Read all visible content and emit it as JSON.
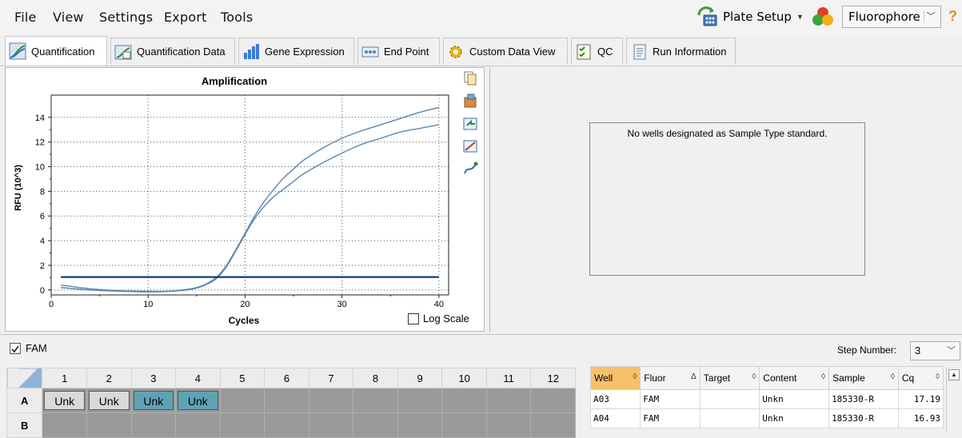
{
  "menu": {
    "items": [
      "File",
      "View",
      "Settings",
      "Export",
      "Tools"
    ],
    "plate_setup_label": "Plate Setup",
    "fluorophore_selected": "Fluorophore",
    "help_symbol": "?"
  },
  "tabs": [
    {
      "label": "Quantification",
      "icon": "amplification-curve-icon",
      "active": true
    },
    {
      "label": "Quantification Data",
      "icon": "quantification-data-icon",
      "active": false
    },
    {
      "label": "Gene Expression",
      "icon": "bar-chart-icon",
      "active": false
    },
    {
      "label": "End Point",
      "icon": "endpoint-icon",
      "active": false
    },
    {
      "label": "Custom Data View",
      "icon": "gear-icon",
      "active": false
    },
    {
      "label": "QC",
      "icon": "checklist-icon",
      "active": false
    },
    {
      "label": "Run Information",
      "icon": "document-icon",
      "active": false
    }
  ],
  "chart_data": {
    "type": "line",
    "title": "Amplification",
    "xlabel": "Cycles",
    "ylabel": "RFU (10^3)",
    "xlim": [
      0,
      41
    ],
    "ylim": [
      -0.4,
      15.8
    ],
    "xticks": [
      0,
      10,
      20,
      30,
      40
    ],
    "yticks": [
      0,
      2,
      4,
      6,
      8,
      10,
      12,
      14
    ],
    "grid": true,
    "series": [
      {
        "x": [
          1,
          4,
          7,
          10,
          12,
          14,
          15,
          16,
          17,
          18,
          19,
          20,
          21,
          22,
          23,
          24,
          25,
          26,
          28,
          30,
          32,
          34,
          36,
          38,
          40
        ],
        "y": [
          0.4,
          0.1,
          -0.05,
          -0.1,
          -0.1,
          0.05,
          0.2,
          0.5,
          1.0,
          1.9,
          3.2,
          4.6,
          6.0,
          7.2,
          8.2,
          9.1,
          9.8,
          10.5,
          11.5,
          12.3,
          12.9,
          13.4,
          13.9,
          14.4,
          14.8
        ]
      },
      {
        "x": [
          1,
          4,
          7,
          10,
          12,
          14,
          15,
          16,
          17,
          18,
          19,
          20,
          21,
          22,
          23,
          24,
          25,
          26,
          28,
          30,
          32,
          34,
          36,
          38,
          40
        ],
        "y": [
          0.2,
          0.0,
          -0.1,
          -0.15,
          -0.12,
          0.0,
          0.15,
          0.45,
          0.9,
          1.8,
          3.1,
          4.5,
          5.8,
          6.8,
          7.6,
          8.2,
          8.8,
          9.4,
          10.3,
          11.1,
          11.8,
          12.3,
          12.8,
          13.1,
          13.4
        ]
      }
    ],
    "threshold": 1.05,
    "log_scale_label": "Log Scale",
    "log_scale_checked": false
  },
  "chart_toolbar_icons": [
    "copy-icon",
    "paste-icon",
    "export-image-icon",
    "zoom-icon",
    "curve-settings-icon"
  ],
  "standard_message": "No wells designated as Sample Type standard.",
  "fam": {
    "label": "FAM",
    "checked": true
  },
  "step": {
    "label": "Step Number:",
    "value": "3"
  },
  "plate": {
    "columns": [
      "1",
      "2",
      "3",
      "4",
      "5",
      "6",
      "7",
      "8",
      "9",
      "10",
      "11",
      "12"
    ],
    "rows": [
      {
        "label": "A",
        "cells": [
          "Unk",
          "Unk",
          "Unk",
          "Unk",
          "",
          "",
          "",
          "",
          "",
          "",
          "",
          ""
        ]
      },
      {
        "label": "B",
        "cells": [
          "",
          "",
          "",
          "",
          "",
          "",
          "",
          "",
          "",
          "",
          "",
          ""
        ]
      }
    ]
  },
  "results": {
    "headers": [
      {
        "label": "Well",
        "sort": "◊"
      },
      {
        "label": "Fluor",
        "sort": "Δ"
      },
      {
        "label": "Target",
        "sort": "◊"
      },
      {
        "label": "Content",
        "sort": "◊"
      },
      {
        "label": "Sample",
        "sort": "◊"
      },
      {
        "label": "Cq",
        "sort": "◊"
      }
    ],
    "rows": [
      [
        "A03",
        "FAM",
        "",
        "Unkn",
        "185330-R",
        "17.19"
      ],
      [
        "A04",
        "FAM",
        "",
        "Unkn",
        "185330-R",
        "16.93"
      ]
    ]
  },
  "colors": {
    "curve": "#5b86b0",
    "threshold": "#123e7a",
    "unk_grey": "#d9d9d9",
    "unk_teal": "#5fa3b3",
    "plate_empty": "#9a9a9a",
    "sorted_header": "#f7c06a"
  }
}
